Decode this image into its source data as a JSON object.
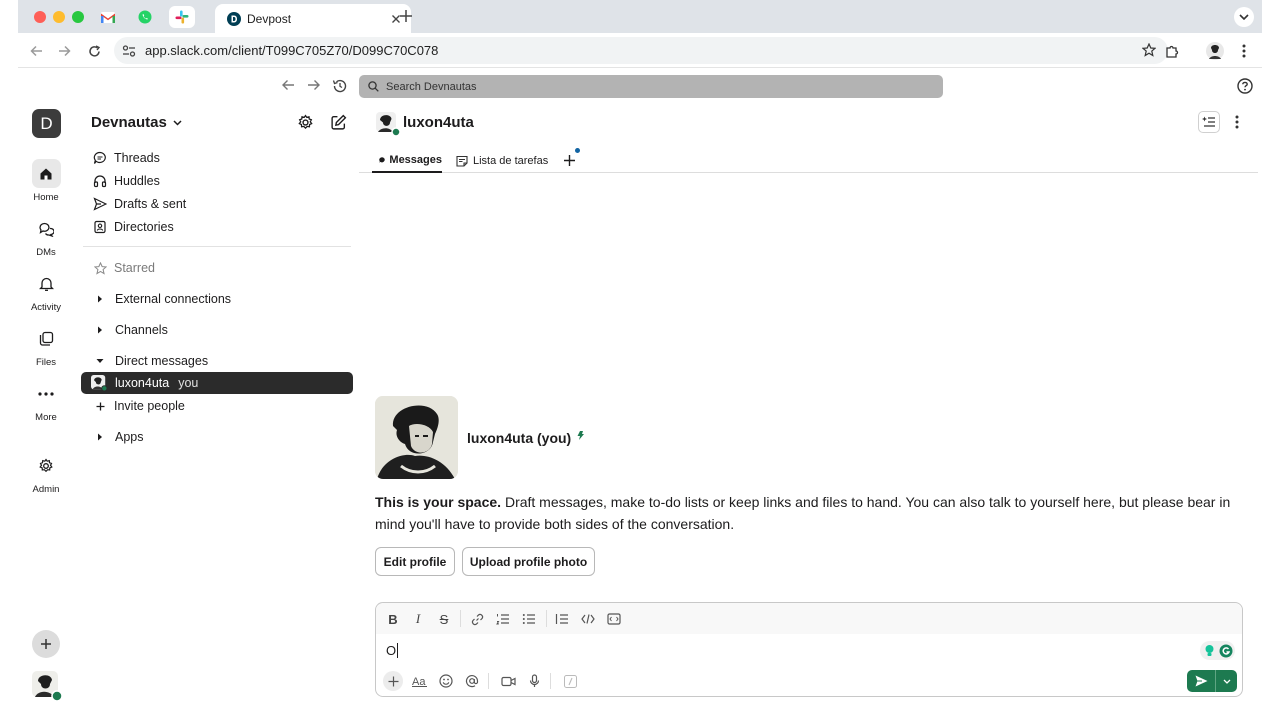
{
  "browser": {
    "tabs": [
      {
        "name": "gmail-tab",
        "icon": "gmail-icon"
      },
      {
        "name": "whatsapp-tab",
        "icon": "whatsapp-icon"
      },
      {
        "name": "slack-tab",
        "icon": "slack-icon"
      }
    ],
    "active_tab": {
      "title": "Devpost",
      "icon": "devpost-icon"
    },
    "url": "app.slack.com/client/T099C705Z70/D099C70C078"
  },
  "slack": {
    "search_placeholder": "Search Devnautas"
  },
  "rail": {
    "workspace_initial": "D",
    "items": [
      {
        "label": "Home",
        "icon": "home-icon"
      },
      {
        "label": "DMs",
        "icon": "dms-icon"
      },
      {
        "label": "Activity",
        "icon": "bell-icon"
      },
      {
        "label": "Files",
        "icon": "files-icon"
      },
      {
        "label": "More",
        "icon": "more-icon"
      },
      {
        "label": "Admin",
        "icon": "gear-icon"
      }
    ]
  },
  "sidebar": {
    "workspace_name": "Devnautas",
    "nav": [
      {
        "label": "Threads",
        "icon": "threads-icon"
      },
      {
        "label": "Huddles",
        "icon": "headphones-icon"
      },
      {
        "label": "Drafts & sent",
        "icon": "send-icon"
      },
      {
        "label": "Directories",
        "icon": "directory-icon"
      }
    ],
    "starred": "Starred",
    "sections": {
      "external": "External connections",
      "channels": "Channels",
      "dms": "Direct messages",
      "apps": "Apps"
    },
    "dm_active": {
      "name": "luxon4uta",
      "suffix": "you"
    },
    "invite": "Invite people"
  },
  "main": {
    "channel_name": "luxon4uta",
    "tabs": [
      {
        "label": "Messages"
      },
      {
        "label": "Lista de tarefas"
      }
    ],
    "profile_name": "luxon4uta (you)",
    "intro_bold": "This is your space.",
    "intro_text": " Draft messages, make to-do lists or keep links and files to hand. You can also talk to yourself here, but please bear in mind you'll have to provide both sides of the conversation.",
    "edit_profile": "Edit profile",
    "upload_photo": "Upload profile photo",
    "composer_value": "O",
    "colors": {
      "accent_green": "#1d7a50",
      "active_dm_bg": "#2b2b2b"
    }
  }
}
